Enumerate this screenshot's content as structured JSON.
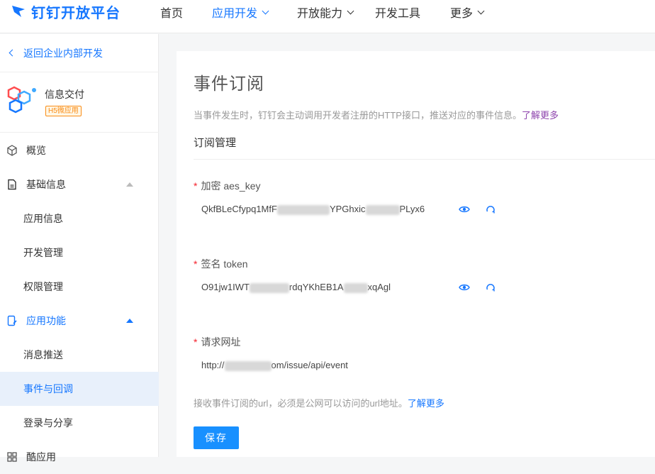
{
  "nav": {
    "logo_text": "钉钉开放平台",
    "items": [
      {
        "label": "首页",
        "has_dropdown": false,
        "active": false
      },
      {
        "label": "应用开发",
        "has_dropdown": true,
        "active": true
      },
      {
        "label": "开放能力",
        "has_dropdown": true,
        "active": false
      },
      {
        "label": "开发工具",
        "has_dropdown": false,
        "active": false
      },
      {
        "label": "更多",
        "has_dropdown": true,
        "active": false
      }
    ],
    "accent_color": "#1677ff"
  },
  "sidebar": {
    "back_label": "返回企业内部开发",
    "app": {
      "name": "信息交付",
      "tag": "H5微应用"
    },
    "items": [
      {
        "label": "概览",
        "icon": "cube-icon"
      },
      {
        "label": "基础信息",
        "icon": "document-icon"
      },
      {
        "label": "应用信息"
      },
      {
        "label": "开发管理"
      },
      {
        "label": "权限管理"
      },
      {
        "label": "应用功能",
        "icon": "phone-edit-icon"
      },
      {
        "label": "消息推送"
      },
      {
        "label": "事件与回调"
      },
      {
        "label": "登录与分享"
      },
      {
        "label": "酷应用"
      }
    ]
  },
  "main": {
    "title": "事件订阅",
    "description": "当事件发生时，钉钉会主动调用开发者注册的HTTP接口，推送对应的事件信息。",
    "learn_more": "了解更多",
    "section_title": "订阅管理",
    "fields": [
      {
        "required_mark": "*",
        "label": "加密 aes_key",
        "value_start": "QkfBLeCfypq1MfF",
        "value_mid": "YPGhxic",
        "value_end": "PLyx6"
      },
      {
        "required_mark": "*",
        "label": "签名 token",
        "value_start": "O91jw1IWT",
        "value_mid": "rdqYKhEB1A",
        "value_end": "xqAgl"
      },
      {
        "required_mark": "*",
        "label": "请求网址",
        "value_start": "http://",
        "value_end": "om/issue/api/event"
      }
    ],
    "hint": "接收事件订阅的url，必须是公网可以访问的url地址。",
    "hint_link": "了解更多",
    "save_label": "保存"
  }
}
